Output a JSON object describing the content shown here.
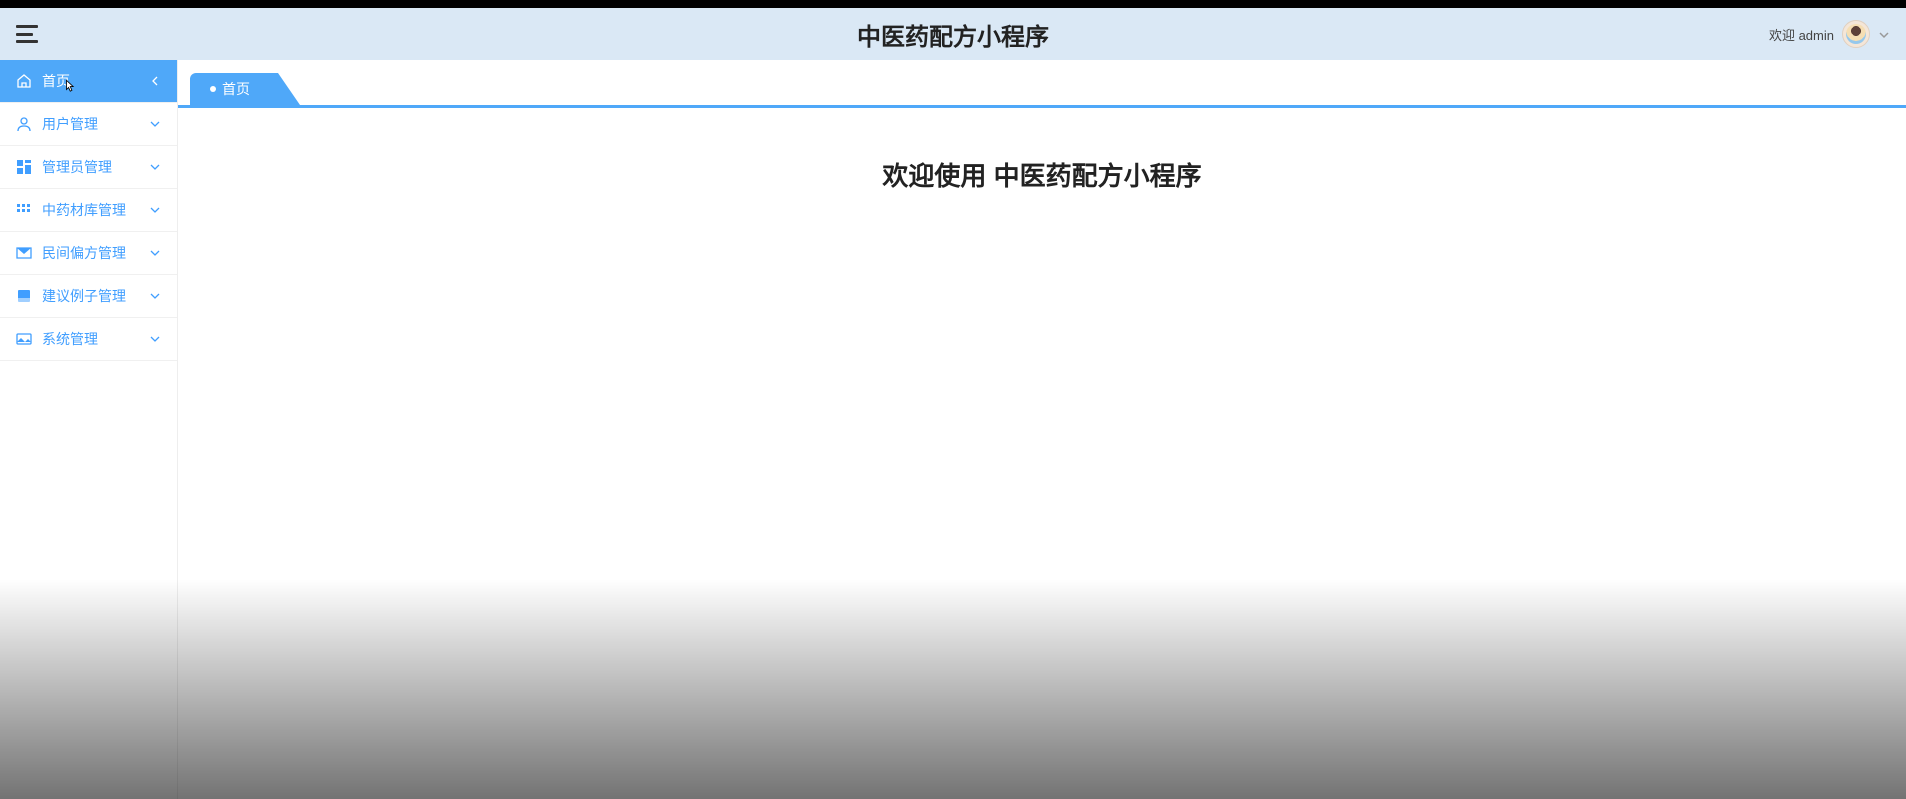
{
  "header": {
    "title": "中医药配方小程序",
    "welcome_prefix": "欢迎 ",
    "username": "admin"
  },
  "sidebar": {
    "items": [
      {
        "icon": "home",
        "label": "首页",
        "active": true,
        "expandable": true
      },
      {
        "icon": "user",
        "label": "用户管理",
        "active": false,
        "expandable": true
      },
      {
        "icon": "grid4",
        "label": "管理员管理",
        "active": false,
        "expandable": true
      },
      {
        "icon": "grid6",
        "label": "中药材库管理",
        "active": false,
        "expandable": true
      },
      {
        "icon": "mail",
        "label": "民间偏方管理",
        "active": false,
        "expandable": true
      },
      {
        "icon": "document",
        "label": "建议例子管理",
        "active": false,
        "expandable": true
      },
      {
        "icon": "image",
        "label": "系统管理",
        "active": false,
        "expandable": true
      }
    ]
  },
  "tabs": [
    {
      "label": "首页",
      "active": true
    }
  ],
  "main": {
    "welcome_text": "欢迎使用 中医药配方小程序"
  }
}
